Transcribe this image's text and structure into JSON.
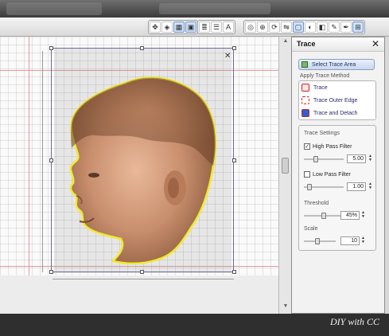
{
  "toolbar": {
    "groups": [
      {
        "icons": [
          "move-icon",
          "paint-icon",
          "grid-icon",
          "image-icon"
        ]
      },
      {
        "icons": [
          "layers-icon",
          "align-icon",
          "text-tool-icon"
        ]
      },
      {
        "icons": [
          "weld-icon",
          "transform-icon",
          "rotate-icon",
          "flip-icon",
          "trace-icon",
          "image-effects-icon",
          "color-fill-icon",
          "pencil-icon",
          "pen-icon",
          "grid-toggle-icon"
        ]
      }
    ],
    "text_icon_glyph": "A"
  },
  "canvas": {
    "colors": {
      "selection": "#6c6c9a",
      "outline": "#f1ea2a",
      "guide": "#e79a9a"
    }
  },
  "panel": {
    "title": "Trace",
    "select_trace_area": "Select Trace Area",
    "apply_label": "Apply Trace Method",
    "methods": [
      {
        "label": "Trace",
        "icon": "trace-icon"
      },
      {
        "label": "Trace Outer Edge",
        "icon": "trace-outer-edge-icon"
      },
      {
        "label": "Trace and Detach",
        "icon": "trace-detach-icon"
      }
    ],
    "settings": {
      "title": "Trace Settings",
      "high_pass": {
        "label": "High Pass Filter",
        "checked": true,
        "value": "5.00"
      },
      "low_pass": {
        "label": "Low Pass Filter",
        "checked": false,
        "value": "1.00"
      },
      "threshold": {
        "label": "Threshold",
        "value": "45%"
      },
      "scale": {
        "label": "Scale",
        "value": "10"
      }
    }
  },
  "watermark": "DIY with CC"
}
